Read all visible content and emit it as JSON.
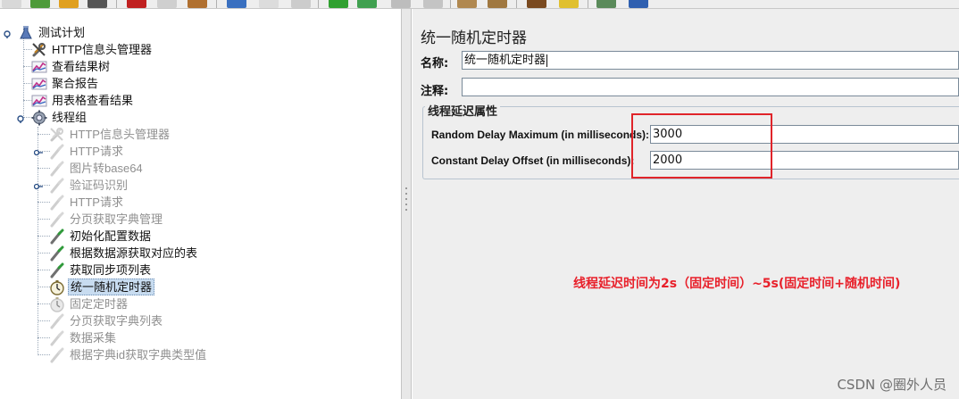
{
  "tree": {
    "items": [
      {
        "label": "测试计划",
        "icon": "test-plan-flask-icon",
        "enabled": true
      },
      {
        "label": "HTTP信息头管理器",
        "icon": "wrench-icon",
        "enabled": true
      },
      {
        "label": "查看结果树",
        "icon": "chart-listener-icon",
        "enabled": true
      },
      {
        "label": "聚合报告",
        "icon": "chart-listener-icon",
        "enabled": true
      },
      {
        "label": "用表格查看结果",
        "icon": "chart-listener-icon",
        "enabled": true
      },
      {
        "label": "线程组",
        "icon": "gear-icon",
        "enabled": true
      },
      {
        "label": "HTTP信息头管理器",
        "icon": "wrench-icon",
        "enabled": false
      },
      {
        "label": "HTTP请求",
        "icon": "sampler-pipette-icon",
        "enabled": false
      },
      {
        "label": "图片转base64",
        "icon": "sampler-pipette-icon",
        "enabled": false
      },
      {
        "label": "验证码识别",
        "icon": "sampler-pipette-icon",
        "enabled": false
      },
      {
        "label": "HTTP请求",
        "icon": "sampler-pipette-icon",
        "enabled": false
      },
      {
        "label": "分页获取字典管理",
        "icon": "sampler-pipette-icon",
        "enabled": false
      },
      {
        "label": "初始化配置数据",
        "icon": "sampler-pipette-icon",
        "enabled": true
      },
      {
        "label": "根据数据源获取对应的表",
        "icon": "sampler-pipette-icon",
        "enabled": true
      },
      {
        "label": "获取同步项列表",
        "icon": "sampler-pipette-icon",
        "enabled": true
      },
      {
        "label": "统一随机定时器",
        "icon": "timer-clock-icon",
        "enabled": true,
        "selected": true
      },
      {
        "label": "固定定时器",
        "icon": "timer-clock-icon",
        "enabled": false
      },
      {
        "label": "分页获取字典列表",
        "icon": "sampler-pipette-icon",
        "enabled": false
      },
      {
        "label": "数据采集",
        "icon": "sampler-pipette-icon",
        "enabled": false
      },
      {
        "label": "根据字典id获取字典类型值",
        "icon": "sampler-pipette-icon",
        "enabled": false
      }
    ]
  },
  "panel": {
    "title": "统一随机定时器",
    "name_label": "名称:",
    "name_value": "统一随机定时器",
    "comment_label": "注释:",
    "comment_value": "",
    "group_title": "线程延迟属性",
    "random_delay_label": "Random Delay Maximum (in milliseconds):",
    "random_delay_value": "3000",
    "constant_delay_label": "Constant Delay Offset (in milliseconds):",
    "constant_delay_value": "2000"
  },
  "annotation": {
    "text": "线程延迟时间为2s（固定时间）~5s(固定时间+随机时间)",
    "color": "#e8202a"
  },
  "watermark": "CSDN @圈外人员",
  "colors": {
    "selection": "#c8dcf0",
    "panel_bg": "#eeeeee",
    "highlight_box": "#e0242a"
  }
}
